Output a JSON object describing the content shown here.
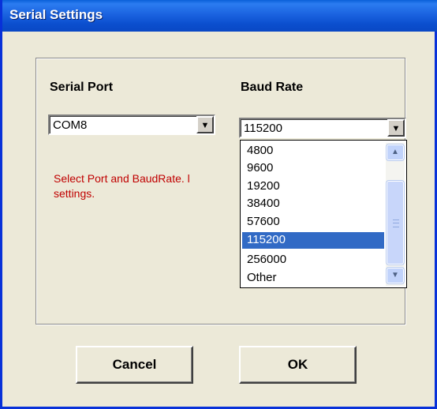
{
  "window": {
    "title": "Serial Settings"
  },
  "serial_port": {
    "label": "Serial Port",
    "value": "COM8"
  },
  "baud_rate": {
    "label": "Baud Rate",
    "value": "115200",
    "options": [
      "4800",
      "9600",
      "19200",
      "38400",
      "57600",
      "115200",
      "256000",
      "Other"
    ],
    "selected_index": 5
  },
  "hint": {
    "text": "Select Port and BaudRate. l\nsettings."
  },
  "buttons": {
    "cancel": "Cancel",
    "ok": "OK"
  },
  "colors": {
    "title_bar": "#0a5fd8",
    "hint_text": "#c00000",
    "selection": "#316ac5",
    "dialog_bg": "#ece9d8"
  },
  "icons": {
    "dropdown": "chevron-down-icon",
    "scroll_up": "scroll-up-icon",
    "scroll_down": "scroll-down-icon"
  }
}
